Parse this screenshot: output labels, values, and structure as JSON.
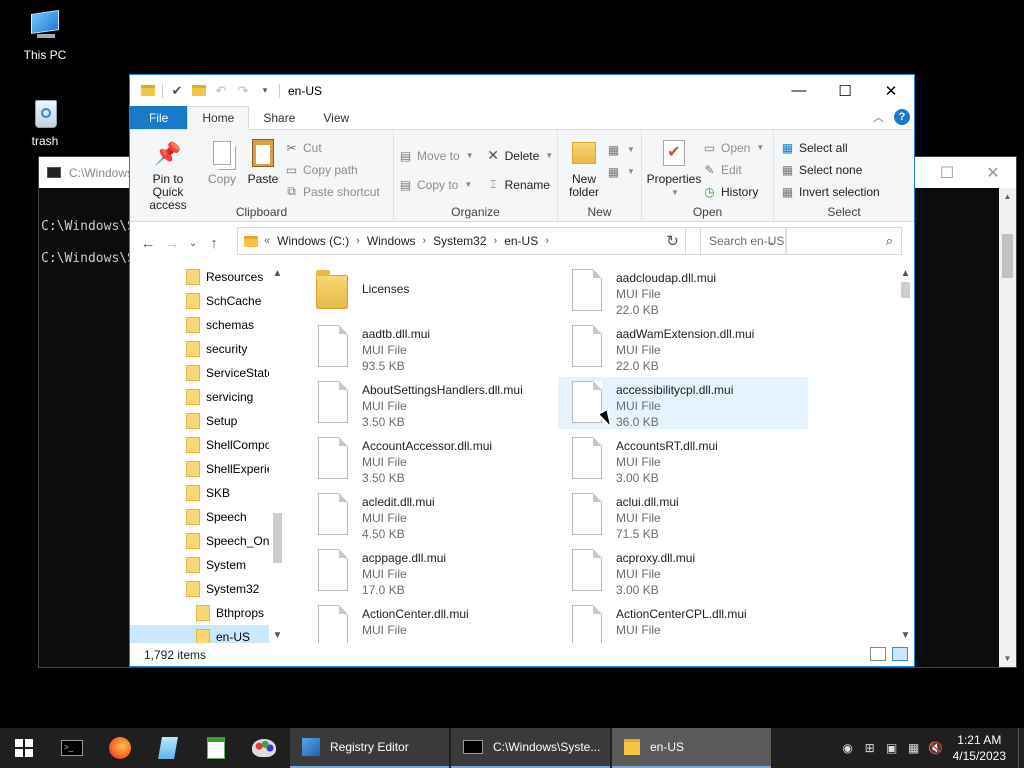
{
  "desktop": {
    "icons": [
      {
        "label": "This PC"
      },
      {
        "label": "trash"
      }
    ]
  },
  "console": {
    "title": "C:\\Windows\\",
    "lines": [
      "C:\\Windows\\S",
      "C:\\Windows\\S"
    ]
  },
  "explorer": {
    "title": "en-US",
    "tabs": {
      "file": "File",
      "home": "Home",
      "share": "Share",
      "view": "View"
    },
    "ribbon": {
      "clipboard": {
        "label": "Clipboard",
        "pin": "Pin to Quick access",
        "copy": "Copy",
        "paste": "Paste",
        "cut": "Cut",
        "copy_path": "Copy path",
        "paste_shortcut": "Paste shortcut"
      },
      "organize": {
        "label": "Organize",
        "move_to": "Move to",
        "copy_to": "Copy to",
        "delete": "Delete",
        "rename": "Rename"
      },
      "new": {
        "label": "New",
        "new_folder": "New folder"
      },
      "open": {
        "label": "Open",
        "properties": "Properties",
        "open": "Open",
        "edit": "Edit",
        "history": "History"
      },
      "select": {
        "label": "Select",
        "select_all": "Select all",
        "select_none": "Select none",
        "invert": "Invert selection"
      }
    },
    "address": {
      "prefix": "«",
      "crumbs": [
        "Windows (C:)",
        "Windows",
        "System32",
        "en-US"
      ]
    },
    "search": {
      "placeholder": "Search en-US"
    },
    "nav_items": [
      "Resources",
      "SchCache",
      "schemas",
      "security",
      "ServiceState",
      "servicing",
      "Setup",
      "ShellComponents",
      "ShellExperiences",
      "SKB",
      "Speech",
      "Speech_OneCore",
      "System",
      "System32",
      "Bthprops",
      "en-US"
    ],
    "files": [
      {
        "name": "Licenses",
        "type": "",
        "size": "",
        "kind": "folder"
      },
      {
        "name": "aadcloudap.dll.mui",
        "type": "MUI File",
        "size": "22.0 KB",
        "kind": "file"
      },
      {
        "name": "aadtb.dll.mui",
        "type": "MUI File",
        "size": "93.5 KB",
        "kind": "file"
      },
      {
        "name": "aadWamExtension.dll.mui",
        "type": "MUI File",
        "size": "22.0 KB",
        "kind": "file"
      },
      {
        "name": "AboutSettingsHandlers.dll.mui",
        "type": "MUI File",
        "size": "3.50 KB",
        "kind": "file"
      },
      {
        "name": "accessibilitycpl.dll.mui",
        "type": "MUI File",
        "size": "36.0 KB",
        "kind": "file"
      },
      {
        "name": "AccountAccessor.dll.mui",
        "type": "MUI File",
        "size": "3.50 KB",
        "kind": "file"
      },
      {
        "name": "AccountsRT.dll.mui",
        "type": "MUI File",
        "size": "3.00 KB",
        "kind": "file"
      },
      {
        "name": "acledit.dll.mui",
        "type": "MUI File",
        "size": "4.50 KB",
        "kind": "file"
      },
      {
        "name": "aclui.dll.mui",
        "type": "MUI File",
        "size": "71.5 KB",
        "kind": "file"
      },
      {
        "name": "acppage.dll.mui",
        "type": "MUI File",
        "size": "17.0 KB",
        "kind": "file"
      },
      {
        "name": "acproxy.dll.mui",
        "type": "MUI File",
        "size": "3.00 KB",
        "kind": "file"
      },
      {
        "name": "ActionCenter.dll.mui",
        "type": "MUI File",
        "size": "",
        "kind": "file"
      },
      {
        "name": "ActionCenterCPL.dll.mui",
        "type": "MUI File",
        "size": "",
        "kind": "file"
      }
    ],
    "status": {
      "count": "1,792 items"
    }
  },
  "taskbar": {
    "tasks": [
      {
        "label": "Registry Editor"
      },
      {
        "label": "C:\\Windows\\Syste..."
      },
      {
        "label": "en-US"
      }
    ],
    "clock": {
      "time": "1:21 AM",
      "date": "4/15/2023"
    }
  }
}
